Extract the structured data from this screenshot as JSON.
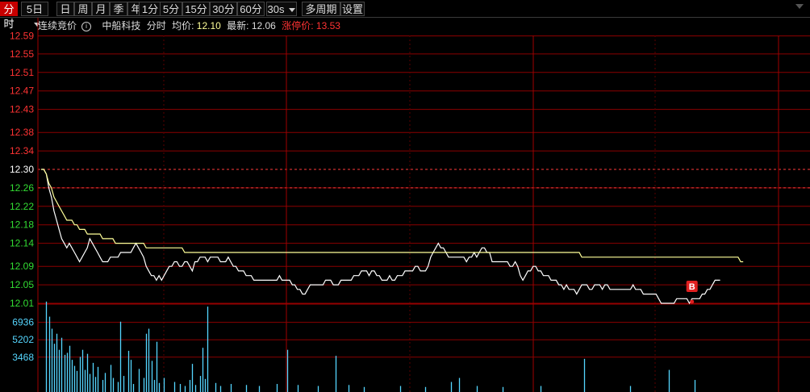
{
  "toolbar": {
    "items": [
      "分时",
      "5日",
      "日",
      "周",
      "月",
      "季",
      "年",
      "1分",
      "5分",
      "15分",
      "30分",
      "60分",
      "30s",
      "多周期",
      "设置"
    ],
    "active": "分时"
  },
  "info": {
    "auction_label": "连续竞价",
    "stock_name": "中船科技",
    "chart_mode": "分时",
    "avg_label": "均价:",
    "avg_value": "12.10",
    "latest_label": "最新:",
    "latest_value": "12.06",
    "limit_up_label": "涨停价:",
    "limit_up_value": "13.53"
  },
  "colors": {
    "up": "#ff3333",
    "down": "#33dd33",
    "price_line": "#ffffff",
    "avg_line": "#ffff99",
    "volume": "#55d6ff",
    "grid": "#8b0000",
    "marker": "#e02020"
  },
  "chart_data": {
    "type": "line",
    "title": "",
    "xlabel": "",
    "ylabel": "",
    "ylim": [
      12.01,
      12.59
    ],
    "price_ticks": [
      "12.59",
      "12.55",
      "12.51",
      "12.47",
      "12.43",
      "12.38",
      "12.34",
      "12.30",
      "12.26",
      "12.22",
      "12.18",
      "12.14",
      "12.09",
      "12.05",
      "12.01"
    ],
    "prev_close": "12.30",
    "reference_price": 12.26,
    "series": [
      {
        "key": "price",
        "values": [
          12.3,
          12.3,
          12.29,
          12.26,
          12.24,
          12.21,
          12.19,
          12.17,
          12.15,
          12.14,
          12.13,
          12.14,
          12.13,
          12.12,
          12.11,
          12.1,
          12.11,
          12.12,
          12.13,
          12.15,
          12.14,
          12.13,
          12.12,
          12.11,
          12.1,
          12.1,
          12.1,
          12.11,
          12.11,
          12.11,
          12.11,
          12.12,
          12.12,
          12.12,
          12.12,
          12.12,
          12.13,
          12.14,
          12.13,
          12.12,
          12.11,
          12.09,
          12.08,
          12.07,
          12.07,
          12.06,
          12.07,
          12.06,
          12.07,
          12.08,
          12.09,
          12.09,
          12.1,
          12.1,
          12.09,
          12.09,
          12.1,
          12.1,
          12.09,
          12.08,
          12.1,
          12.1,
          12.11,
          12.11,
          12.11,
          12.1,
          12.11,
          12.11,
          12.11,
          12.11,
          12.1,
          12.1,
          12.1,
          12.11,
          12.1,
          12.09,
          12.09,
          12.08,
          12.08,
          12.08,
          12.07,
          12.07,
          12.07,
          12.06,
          12.06,
          12.06,
          12.06,
          12.06,
          12.06,
          12.06,
          12.06,
          12.06,
          12.06,
          12.07,
          12.06,
          12.06,
          12.06,
          12.06,
          12.05,
          12.05,
          12.04,
          12.04,
          12.03,
          12.03,
          12.04,
          12.05,
          12.05,
          12.05,
          12.05,
          12.05,
          12.05,
          12.06,
          12.06,
          12.06,
          12.05,
          12.05,
          12.05,
          12.06,
          12.06,
          12.06,
          12.06,
          12.06,
          12.07,
          12.07,
          12.07,
          12.08,
          12.08,
          12.08,
          12.07,
          12.08,
          12.08,
          12.07,
          12.07,
          12.06,
          12.06,
          12.06,
          12.07,
          12.06,
          12.06,
          12.07,
          12.07,
          12.07,
          12.08,
          12.08,
          12.08,
          12.08,
          12.09,
          12.09,
          12.08,
          12.08,
          12.08,
          12.09,
          12.11,
          12.12,
          12.13,
          12.14,
          12.13,
          12.13,
          12.12,
          12.11,
          12.11,
          12.11,
          12.11,
          12.11,
          12.11,
          12.11,
          12.1,
          12.11,
          12.11,
          12.12,
          12.11,
          12.12,
          12.13,
          12.13,
          12.12,
          12.12,
          12.1,
          12.1,
          12.1,
          12.1,
          12.1,
          12.1,
          12.1,
          12.09,
          12.09,
          12.1,
          12.09,
          12.07,
          12.06,
          12.07,
          12.08,
          12.08,
          12.09,
          12.09,
          12.08,
          12.08,
          12.07,
          12.07,
          12.07,
          12.06,
          12.06,
          12.06,
          12.05,
          12.05,
          12.04,
          12.05,
          12.04,
          12.04,
          12.04,
          12.03,
          12.04,
          12.05,
          12.05,
          12.05,
          12.04,
          12.04,
          12.05,
          12.05,
          12.05,
          12.04,
          12.05,
          12.05,
          12.04,
          12.04,
          12.04,
          12.04,
          12.04,
          12.04,
          12.04,
          12.04,
          12.04,
          12.05,
          12.04,
          12.04,
          12.04,
          12.03,
          12.03,
          12.03,
          12.03,
          12.03,
          12.03,
          12.02,
          12.01,
          12.01,
          12.01,
          12.01,
          12.01,
          12.01,
          12.02,
          12.02,
          12.02,
          12.02,
          12.02,
          12.01,
          12.02,
          12.02,
          12.02,
          12.02,
          12.03,
          12.03,
          12.04,
          12.04,
          12.05,
          12.06,
          12.06,
          12.06
        ]
      },
      {
        "key": "average",
        "values": [
          12.3,
          12.3,
          12.29,
          12.27,
          12.26,
          12.24,
          12.23,
          12.22,
          12.21,
          12.2,
          12.19,
          12.19,
          12.19,
          12.18,
          12.18,
          12.17,
          12.17,
          12.17,
          12.16,
          12.16,
          12.16,
          12.16,
          12.16,
          12.16,
          12.15,
          12.15,
          12.15,
          12.15,
          12.15,
          12.14,
          12.14,
          12.14,
          12.14,
          12.14,
          12.14,
          12.14,
          12.14,
          12.14,
          12.14,
          12.14,
          12.14,
          12.13,
          12.13,
          12.13,
          12.13,
          12.13,
          12.13,
          12.13,
          12.13,
          12.13,
          12.13,
          12.13,
          12.13,
          12.13,
          12.13,
          12.13,
          12.12,
          12.12,
          12.12,
          12.12,
          12.12,
          12.12,
          12.12,
          12.12,
          12.12,
          12.12,
          12.12,
          12.12,
          12.12,
          12.12,
          12.12,
          12.12,
          12.12,
          12.12,
          12.12,
          12.12,
          12.12,
          12.12,
          12.12,
          12.12,
          12.12,
          12.12,
          12.12,
          12.12,
          12.12,
          12.12,
          12.12,
          12.12,
          12.12,
          12.12,
          12.12,
          12.12,
          12.12,
          12.12,
          12.12,
          12.12,
          12.12,
          12.12,
          12.12,
          12.12,
          12.12,
          12.12,
          12.12,
          12.12,
          12.12,
          12.12,
          12.12,
          12.12,
          12.12,
          12.12,
          12.12,
          12.12,
          12.12,
          12.12,
          12.12,
          12.12,
          12.12,
          12.12,
          12.12,
          12.12,
          12.12,
          12.12,
          12.12,
          12.12,
          12.12,
          12.12,
          12.12,
          12.12,
          12.12,
          12.12,
          12.12,
          12.12,
          12.12,
          12.12,
          12.12,
          12.12,
          12.12,
          12.12,
          12.12,
          12.12,
          12.12,
          12.12,
          12.12,
          12.12,
          12.12,
          12.12,
          12.12,
          12.12,
          12.12,
          12.12,
          12.12,
          12.12,
          12.12,
          12.12,
          12.12,
          12.12,
          12.12,
          12.12,
          12.12,
          12.12,
          12.12,
          12.12,
          12.12,
          12.12,
          12.12,
          12.12,
          12.12,
          12.12,
          12.12,
          12.12,
          12.12,
          12.12,
          12.12,
          12.12,
          12.12,
          12.12,
          12.12,
          12.12,
          12.12,
          12.12,
          12.12,
          12.12,
          12.12,
          12.12,
          12.12,
          12.12,
          12.12,
          12.12,
          12.12,
          12.12,
          12.12,
          12.12,
          12.12,
          12.12,
          12.12,
          12.12,
          12.12,
          12.12,
          12.12,
          12.12,
          12.12,
          12.12,
          12.12,
          12.12,
          12.12,
          12.12,
          12.12,
          12.12,
          12.12,
          12.12,
          12.12,
          12.11,
          12.11,
          12.11,
          12.11,
          12.11,
          12.11,
          12.11,
          12.11,
          12.11,
          12.11,
          12.11,
          12.11,
          12.11,
          12.11,
          12.11,
          12.11,
          12.11,
          12.11,
          12.11,
          12.11,
          12.11,
          12.11,
          12.11,
          12.11,
          12.11,
          12.11,
          12.11,
          12.11,
          12.11,
          12.11,
          12.11,
          12.11,
          12.11,
          12.11,
          12.11,
          12.11,
          12.11,
          12.11,
          12.11,
          12.11,
          12.11,
          12.11,
          12.11,
          12.11,
          12.11,
          12.11,
          12.11,
          12.11,
          12.11,
          12.11,
          12.11,
          12.11,
          12.11,
          12.11,
          12.11,
          12.11,
          12.11,
          12.11,
          12.11,
          12.11,
          12.11,
          12.11,
          12.1,
          12.1
        ]
      }
    ],
    "volume_ticks": [
      "6936",
      "5202",
      "3468"
    ],
    "volume_range": [
      0,
      8670
    ],
    "volume_bars": [
      {
        "i": 2,
        "v": 9000
      },
      {
        "i": 3,
        "v": 7500
      },
      {
        "i": 4,
        "v": 6300
      },
      {
        "i": 5,
        "v": 4800
      },
      {
        "i": 6,
        "v": 5800
      },
      {
        "i": 7,
        "v": 4200
      },
      {
        "i": 8,
        "v": 5400
      },
      {
        "i": 9,
        "v": 3700
      },
      {
        "i": 10,
        "v": 3900
      },
      {
        "i": 11,
        "v": 4600
      },
      {
        "i": 12,
        "v": 3200
      },
      {
        "i": 13,
        "v": 2600
      },
      {
        "i": 14,
        "v": 2100
      },
      {
        "i": 15,
        "v": 3500
      },
      {
        "i": 16,
        "v": 4200
      },
      {
        "i": 17,
        "v": 2200
      },
      {
        "i": 18,
        "v": 3800
      },
      {
        "i": 19,
        "v": 1800
      },
      {
        "i": 20,
        "v": 2900
      },
      {
        "i": 21,
        "v": 1500
      },
      {
        "i": 22,
        "v": 2500
      },
      {
        "i": 24,
        "v": 1200
      },
      {
        "i": 25,
        "v": 1900
      },
      {
        "i": 27,
        "v": 2700
      },
      {
        "i": 28,
        "v": 1400
      },
      {
        "i": 30,
        "v": 1000
      },
      {
        "i": 31,
        "v": 7000
      },
      {
        "i": 32,
        "v": 1600
      },
      {
        "i": 34,
        "v": 4100
      },
      {
        "i": 35,
        "v": 3200
      },
      {
        "i": 36,
        "v": 800
      },
      {
        "i": 38,
        "v": 2300
      },
      {
        "i": 40,
        "v": 1400
      },
      {
        "i": 41,
        "v": 5800
      },
      {
        "i": 42,
        "v": 6300
      },
      {
        "i": 43,
        "v": 3100
      },
      {
        "i": 44,
        "v": 1200
      },
      {
        "i": 45,
        "v": 5000
      },
      {
        "i": 46,
        "v": 900
      },
      {
        "i": 48,
        "v": 1400
      },
      {
        "i": 52,
        "v": 1000
      },
      {
        "i": 54,
        "v": 800
      },
      {
        "i": 56,
        "v": 600
      },
      {
        "i": 58,
        "v": 1200
      },
      {
        "i": 59,
        "v": 2800
      },
      {
        "i": 60,
        "v": 700
      },
      {
        "i": 62,
        "v": 1600
      },
      {
        "i": 63,
        "v": 4400
      },
      {
        "i": 64,
        "v": 1300
      },
      {
        "i": 65,
        "v": 8500
      },
      {
        "i": 68,
        "v": 900
      },
      {
        "i": 70,
        "v": 600
      },
      {
        "i": 74,
        "v": 800
      },
      {
        "i": 80,
        "v": 700
      },
      {
        "i": 85,
        "v": 600
      },
      {
        "i": 92,
        "v": 800
      },
      {
        "i": 96,
        "v": 4200
      },
      {
        "i": 100,
        "v": 700
      },
      {
        "i": 108,
        "v": 600
      },
      {
        "i": 115,
        "v": 3600
      },
      {
        "i": 120,
        "v": 700
      },
      {
        "i": 126,
        "v": 500
      },
      {
        "i": 140,
        "v": 600
      },
      {
        "i": 150,
        "v": 500
      },
      {
        "i": 160,
        "v": 1000
      },
      {
        "i": 163,
        "v": 1400
      },
      {
        "i": 170,
        "v": 600
      },
      {
        "i": 180,
        "v": 500
      },
      {
        "i": 195,
        "v": 600
      },
      {
        "i": 212,
        "v": 3300
      },
      {
        "i": 230,
        "v": 600
      },
      {
        "i": 245,
        "v": 2200
      },
      {
        "i": 255,
        "v": 1200
      }
    ],
    "marker": {
      "label": "B",
      "index": 254,
      "price": 12.01
    }
  }
}
